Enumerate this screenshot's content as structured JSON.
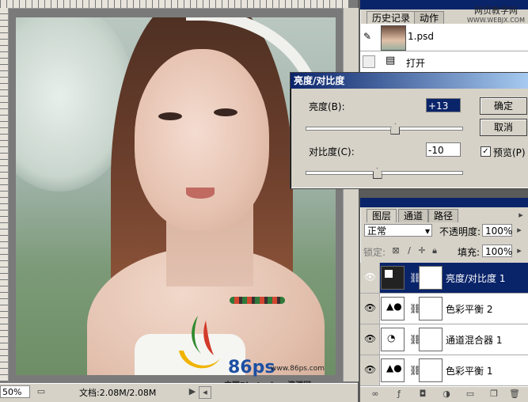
{
  "document": {
    "zoom": "50%",
    "doc_info": "文档:2.08M/2.08M",
    "logo": {
      "brand": "86ps",
      "url": "www.86ps.com",
      "cn": "中国Photoshop资源网"
    }
  },
  "history_panel": {
    "tabs": [
      "历史记录",
      "动作"
    ],
    "items": [
      {
        "label": "1.psd",
        "icon": "snapshot-thumb"
      },
      {
        "label": "打开",
        "icon": "document-icon"
      }
    ],
    "watermark": {
      "line1": "网页教学网",
      "line2": "WWW.WEBJX.COM"
    }
  },
  "dialog": {
    "title": "亮度/对比度",
    "brightness_label": "亮度(B):",
    "brightness_value": "+13",
    "brightness_level": 0.565,
    "contrast_label": "对比度(C):",
    "contrast_value": "-10",
    "contrast_level": 0.45,
    "ok_label": "确定",
    "cancel_label": "取消",
    "preview_label": "预览(P)",
    "preview_checked": true
  },
  "layers_panel": {
    "tabs": [
      "图层",
      "通道",
      "路径"
    ],
    "blend_mode": "正常",
    "opacity_label": "不透明度:",
    "opacity_value": "100%",
    "lock_label": "锁定:",
    "fill_label": "填充:",
    "fill_value": "100%",
    "layers": [
      {
        "name": "亮度/对比度 1",
        "selected": true
      },
      {
        "name": "色彩平衡 2",
        "selected": false
      },
      {
        "name": "通道混合器 1",
        "selected": false
      },
      {
        "name": "色彩平衡 1",
        "selected": false
      }
    ]
  },
  "colors": {
    "title_bar": "#0a246a",
    "panel_bg": "#d6d2c8"
  }
}
